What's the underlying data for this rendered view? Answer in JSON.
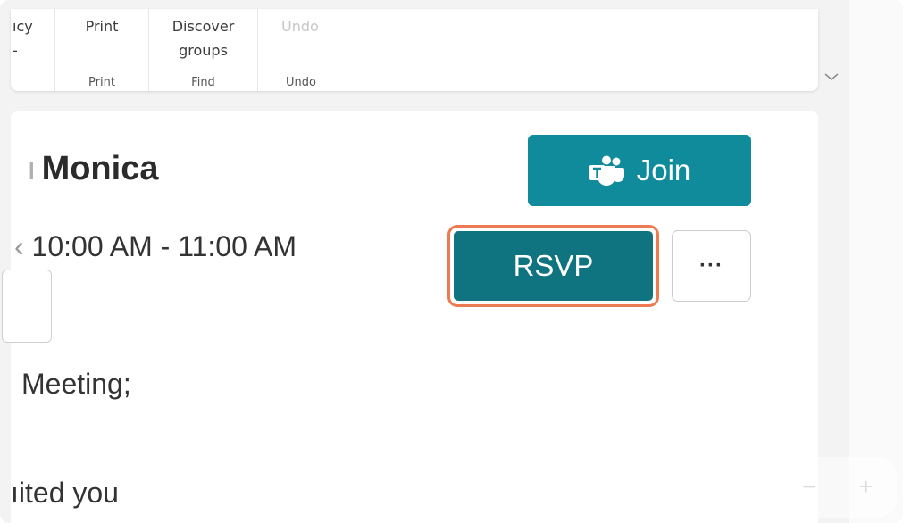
{
  "ribbon": {
    "privacy_label": "ıcy",
    "privacy_sub": "-",
    "print": {
      "button": "Print",
      "group": "Print"
    },
    "find": {
      "button": "Discover groups",
      "group": "Find"
    },
    "undo": {
      "button": "Undo",
      "group": "Undo"
    }
  },
  "event": {
    "title_prefix": "ı",
    "title": "Monica",
    "time_prefix": "‹",
    "time": "10:00 AM - 11:00 AM",
    "meeting": "Meeting;",
    "invited": "ıited you"
  },
  "actions": {
    "join": "Join",
    "join_icon": "teams-icon",
    "rsvp": "RSVP",
    "more": "···"
  },
  "zoom": {
    "minus": "−",
    "plus": "+"
  },
  "colors": {
    "join": "#0f8b9b",
    "rsvp": "#0f7380",
    "focus_ring": "#ec7b52"
  }
}
